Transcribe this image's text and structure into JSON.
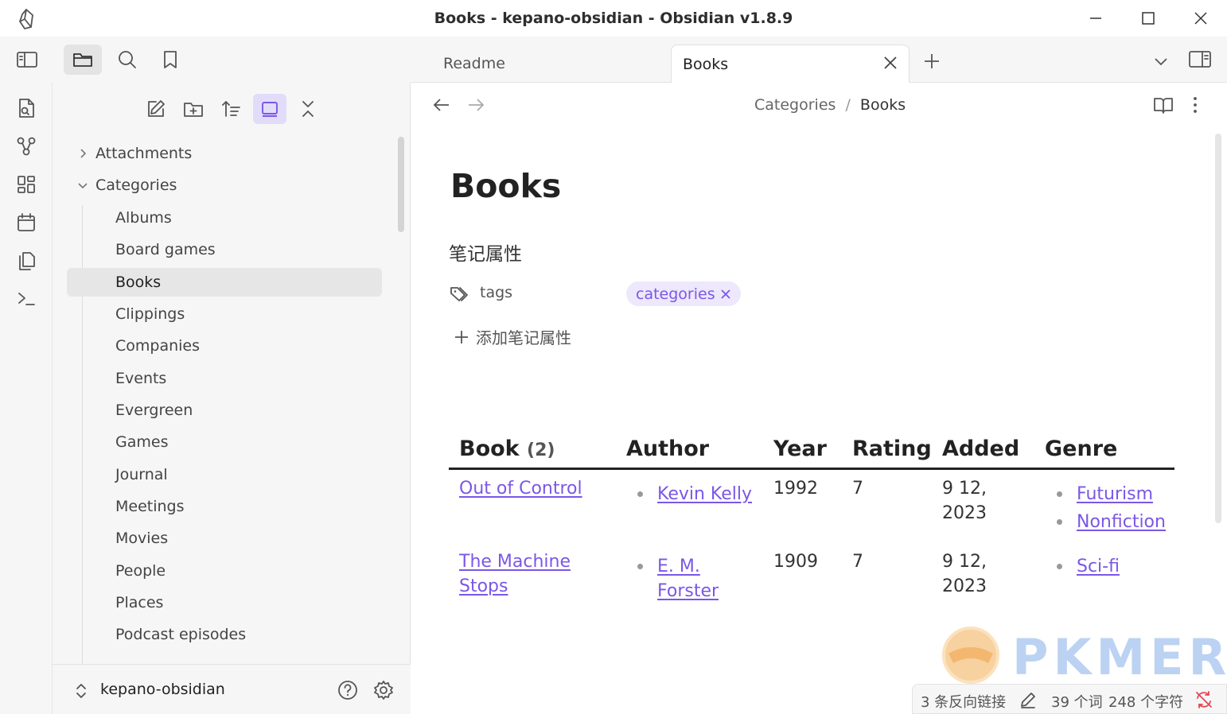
{
  "window": {
    "title": "Books - kepano-obsidian - Obsidian v1.8.9"
  },
  "tabs": [
    {
      "label": "Readme",
      "active": false
    },
    {
      "label": "Books",
      "active": true
    }
  ],
  "explorer": {
    "tree": [
      {
        "label": "Attachments",
        "type": "folder",
        "expanded": false
      },
      {
        "label": "Categories",
        "type": "folder",
        "expanded": true
      },
      {
        "label": "Albums",
        "type": "file"
      },
      {
        "label": "Board games",
        "type": "file"
      },
      {
        "label": "Books",
        "type": "file",
        "selected": true
      },
      {
        "label": "Clippings",
        "type": "file"
      },
      {
        "label": "Companies",
        "type": "file"
      },
      {
        "label": "Events",
        "type": "file"
      },
      {
        "label": "Evergreen",
        "type": "file"
      },
      {
        "label": "Games",
        "type": "file"
      },
      {
        "label": "Journal",
        "type": "file"
      },
      {
        "label": "Meetings",
        "type": "file"
      },
      {
        "label": "Movies",
        "type": "file"
      },
      {
        "label": "People",
        "type": "file"
      },
      {
        "label": "Places",
        "type": "file"
      },
      {
        "label": "Podcast episodes",
        "type": "file"
      }
    ],
    "vault_name": "kepano-obsidian"
  },
  "breadcrumb": {
    "parent": "Categories",
    "separator": "/",
    "current": "Books"
  },
  "note": {
    "title": "Books",
    "properties_heading": "笔记属性",
    "property_name": "tags",
    "tag_value": "categories",
    "add_property_label": "添加笔记属性"
  },
  "table": {
    "headers": {
      "book": "Book",
      "book_count": "(2)",
      "author": "Author",
      "year": "Year",
      "rating": "Rating",
      "added": "Added",
      "genre": "Genre"
    },
    "rows": [
      {
        "book_line1": "Out of Control",
        "book_line2": "",
        "author_line1": "Kevin Kelly",
        "author_line2": "",
        "year": "1992",
        "rating": "7",
        "added_line1": "9 12,",
        "added_line2": "2023",
        "genres": [
          "Futurism",
          "Nonfiction"
        ]
      },
      {
        "book_line1": "The Machine",
        "book_line2": "Stops",
        "author_line1": "E. M.",
        "author_line2": "Forster",
        "year": "1909",
        "rating": "7",
        "added_line1": "9 12,",
        "added_line2": "2023",
        "genres": [
          "Sci-fi"
        ]
      }
    ]
  },
  "status": {
    "backlinks": "3 条反向链接",
    "words": "39 个词",
    "chars": "248 个字符"
  },
  "watermark": {
    "text": "PKMER"
  },
  "colors": {
    "accent": "#7b57e6",
    "tag_bg": "#ede8fc",
    "sync_error": "#e64553"
  }
}
